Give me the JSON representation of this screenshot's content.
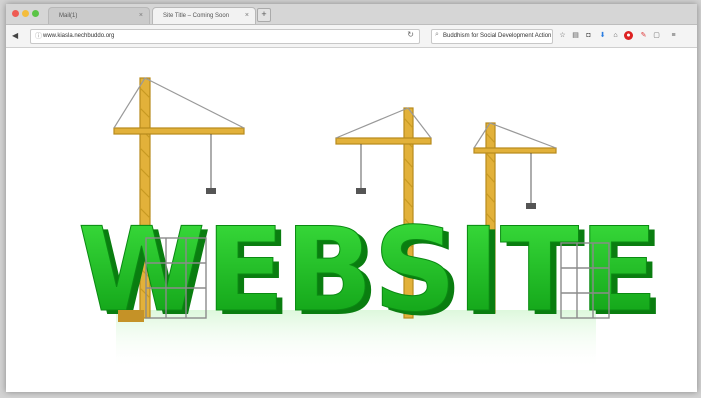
{
  "window": {
    "tabs": [
      {
        "label": "Mail(1)",
        "active": false
      },
      {
        "label": "Site Title – Coming Soon",
        "active": true
      }
    ],
    "new_tab": "+",
    "url": "www.kiasla.nechbuddo.org",
    "search_text": "Buddhism for Social Development Action",
    "toolbar_icons": [
      "star-icon",
      "reader-icon",
      "pocket-icon",
      "info-icon",
      "home-icon",
      "adblock-icon",
      "pen-icon",
      "extension-icon",
      "menu-icon"
    ]
  },
  "content": {
    "hero_word": "WEBSITE",
    "colors": {
      "green": "#16c21a",
      "green_dark": "#0a7d10",
      "crane": "#e2b13a",
      "scaffold": "#8b8b8b"
    }
  }
}
